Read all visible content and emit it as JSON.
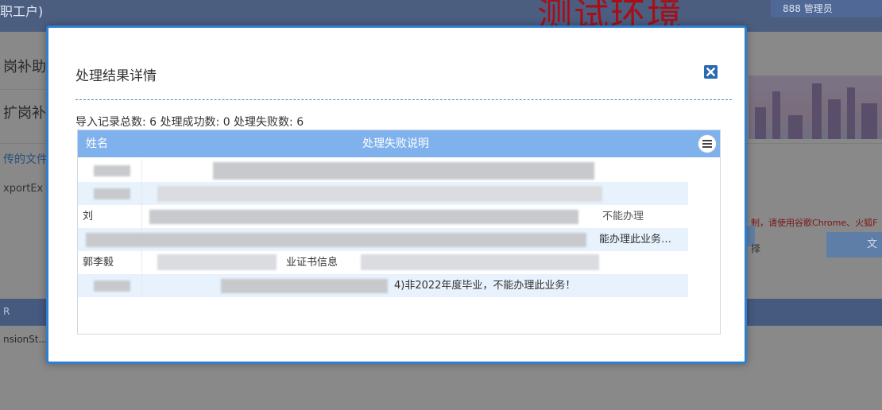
{
  "background": {
    "header_title": "职工户)",
    "banner_text": "测试环境",
    "user_text": "888  管理员",
    "left_items": [
      "岗补助",
      "扩岗补"
    ],
    "left_link": "传的文件",
    "left_gray": "xportEx",
    "warning_text": "制，请使用谷歌Chrome、火狐F",
    "input_label": "择",
    "button_label": "文",
    "table_header_text": "R",
    "table_row_text": "nsionSt..."
  },
  "modal": {
    "title": "处理结果详情",
    "close_icon": "close-icon",
    "summary": "导入记录总数: 6 处理成功数: 0 处理失败数: 6",
    "columns": {
      "name": "姓名",
      "reason": "处理失败说明"
    },
    "menu_icon": "hamburger-menu-icon",
    "rows": [
      {
        "name": "",
        "reason": ""
      },
      {
        "name": "",
        "reason": ""
      },
      {
        "name": "刘",
        "reason": "不能办理"
      },
      {
        "name": "",
        "reason": "能办理此业务…"
      },
      {
        "name": "郭李毅",
        "reason": "业证书信息"
      },
      {
        "name": "",
        "reason": "4)非2022年度毕业，不能办理此业务！"
      }
    ]
  },
  "colors": {
    "modal_border": "#2e7fd0",
    "grid_header": "#7fb1ec",
    "close_button": "#2a6ab0"
  }
}
